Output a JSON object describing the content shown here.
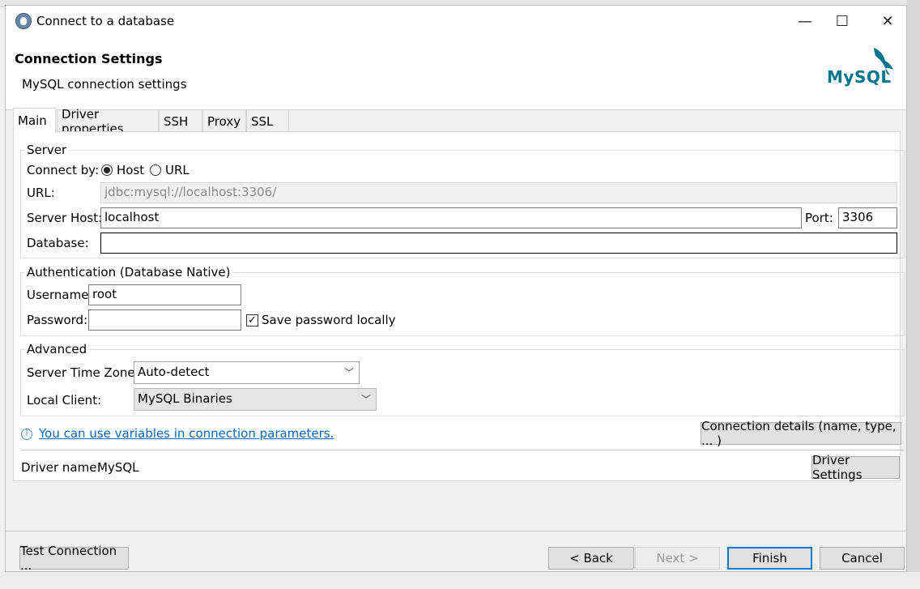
{
  "window": {
    "title": "Connect to a database",
    "minimize_glyph": "—",
    "maximize_glyph": "☐",
    "close_glyph": "✕"
  },
  "header": {
    "title": "Connection Settings",
    "subtitle": "MySQL connection settings",
    "logo_text": "MySQL",
    "logo_color": "#00758f",
    "logo_accent": "#f29111"
  },
  "tabs": [
    {
      "label": "Main",
      "active": true
    },
    {
      "label": "Driver properties"
    },
    {
      "label": "SSH"
    },
    {
      "label": "Proxy"
    },
    {
      "label": "SSL"
    }
  ],
  "server": {
    "group_title": "Server",
    "connect_by_label": "Connect by:",
    "option_host": "Host",
    "option_url": "URL",
    "selected": "Host",
    "url_label": "URL:",
    "url_value": "jdbc:mysql://localhost:3306/",
    "host_label": "Server Host:",
    "host_value": "localhost",
    "port_label": "Port:",
    "port_value": "3306",
    "database_label": "Database:",
    "database_value": ""
  },
  "auth": {
    "group_title": "Authentication (Database Native)",
    "username_label": "Username:",
    "username_value": "root",
    "password_label": "Password:",
    "password_value": "",
    "save_password_label": "Save password locally",
    "save_password_checked": true
  },
  "advanced": {
    "group_title": "Advanced",
    "timezone_label": "Server Time Zone:",
    "timezone_value": "Auto-detect",
    "client_label": "Local Client:",
    "client_value": "MySQL Binaries"
  },
  "info": {
    "icon": "info-icon",
    "link_text": "You can use variables in connection parameters.",
    "details_button": "Connection details (name, type, ... )"
  },
  "driver": {
    "name_label": "Driver name:",
    "name_value": "MySQL",
    "settings_button": "Driver Settings"
  },
  "footer": {
    "test_button": "Test Connection ...",
    "back_button": "< Back",
    "next_button": "Next >",
    "finish_button": "Finish",
    "cancel_button": "Cancel"
  }
}
